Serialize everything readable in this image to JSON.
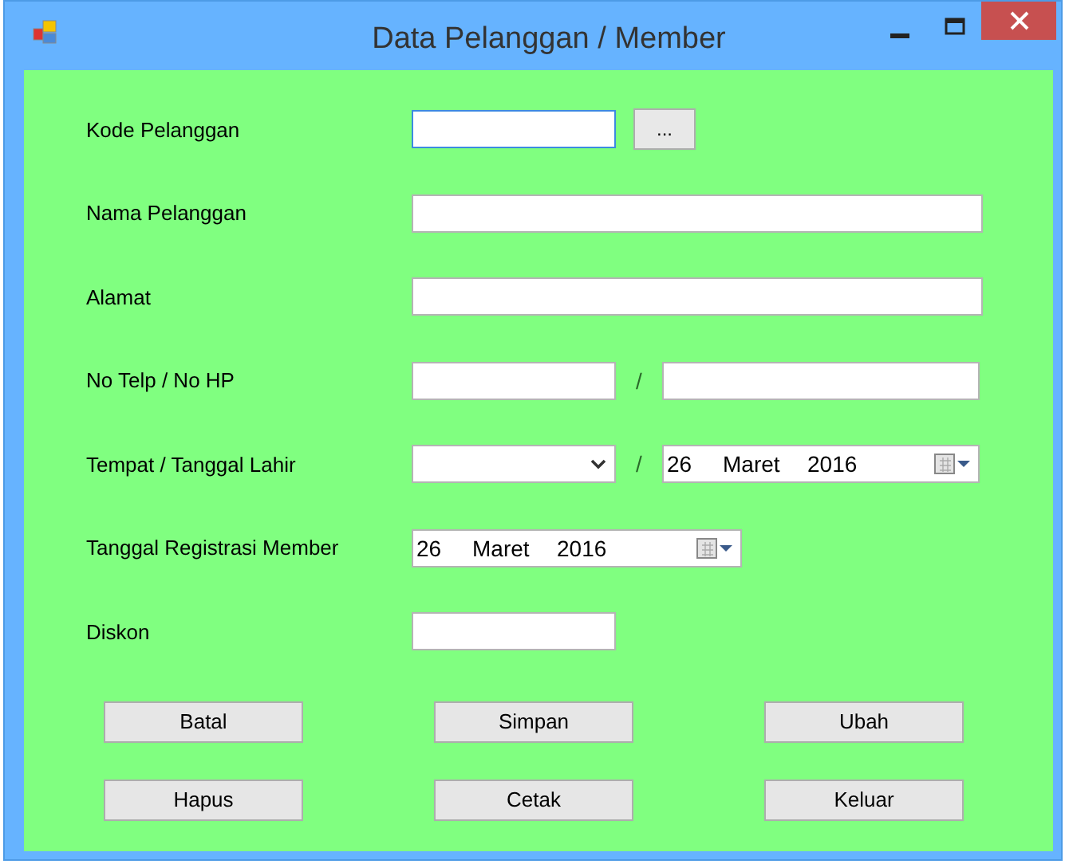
{
  "window": {
    "title": "Data Pelanggan / Member"
  },
  "rows": [
    {
      "label": "Kode Pelanggan",
      "controls": [
        {
          "kind": "text",
          "focused": true
        },
        {
          "kind": "browse",
          "label": "..."
        }
      ]
    },
    {
      "label": "Nama Pelanggan",
      "controls": [
        {
          "kind": "text",
          "focused": false
        }
      ]
    },
    {
      "label": "Alamat",
      "controls": [
        {
          "kind": "text",
          "focused": false
        }
      ]
    },
    {
      "label": "No Telp / No HP",
      "controls": [
        {
          "kind": "text",
          "focused": false
        },
        {
          "kind": "separator",
          "text": "/"
        },
        {
          "kind": "text",
          "focused": false
        }
      ]
    },
    {
      "label": "Tempat / Tanggal Lahir",
      "controls": [
        {
          "kind": "combo"
        },
        {
          "kind": "separator",
          "text": "/"
        },
        {
          "kind": "date",
          "day": "26",
          "month": "Maret",
          "year": "2016"
        }
      ]
    },
    {
      "label": "Tanggal Registrasi Member",
      "controls": [
        {
          "kind": "date",
          "day": "26",
          "month": "Maret",
          "year": "2016"
        }
      ]
    },
    {
      "label": "Diskon",
      "controls": [
        {
          "kind": "text",
          "focused": false
        }
      ]
    }
  ],
  "buttons": [
    "Batal",
    "Simpan",
    "Ubah",
    "Hapus",
    "Cetak",
    "Keluar"
  ]
}
